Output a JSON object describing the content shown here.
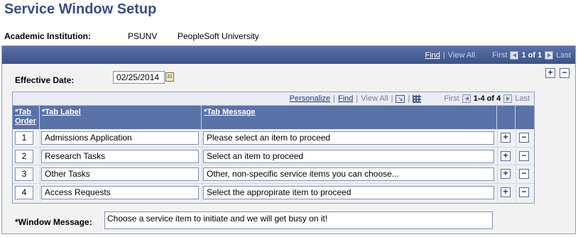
{
  "page_title": "Service Window Setup",
  "institution": {
    "label": "Academic Institution:",
    "code": "PSUNV",
    "name": "PeopleSoft University"
  },
  "outer_nav": {
    "find": "Find",
    "separator": "|",
    "view_all": "View All",
    "first": "First",
    "range": "1 of 1",
    "last": "Last"
  },
  "effective_date": {
    "label": "Effective Date:",
    "value": "02/25/2014"
  },
  "grid_nav": {
    "personalize": "Personalize",
    "separator": "|",
    "find": "Find",
    "view_all": "View All",
    "first": "First",
    "range": "1-4 of 4",
    "last": "Last"
  },
  "columns": {
    "tab_order": "*Tab Order",
    "tab_label": "*Tab Label",
    "tab_message": "*Tab Message"
  },
  "rows": [
    {
      "order": "1",
      "label": "Admissions Application",
      "message": "Please select an item to proceed"
    },
    {
      "order": "2",
      "label": "Research Tasks",
      "message": "Select an item to proceed"
    },
    {
      "order": "3",
      "label": "Other Tasks",
      "message": "Other, non-specific service items you can choose..."
    },
    {
      "order": "4",
      "label": "Access Requests",
      "message": "Select the appropirate item to proceed"
    }
  ],
  "window_message": {
    "label": "*Window Message:",
    "value": "Choose a service item to initiate and we will get busy on it!"
  },
  "buttons": {
    "add": "+",
    "remove": "−"
  },
  "icons": {
    "calendar": "calendar-icon",
    "download": "download-icon",
    "grid_view": "grid-view-icon"
  },
  "colors": {
    "title": "#3a4d84",
    "header_bg": "#5a72a8",
    "panel_border": "#8d9dc3"
  }
}
